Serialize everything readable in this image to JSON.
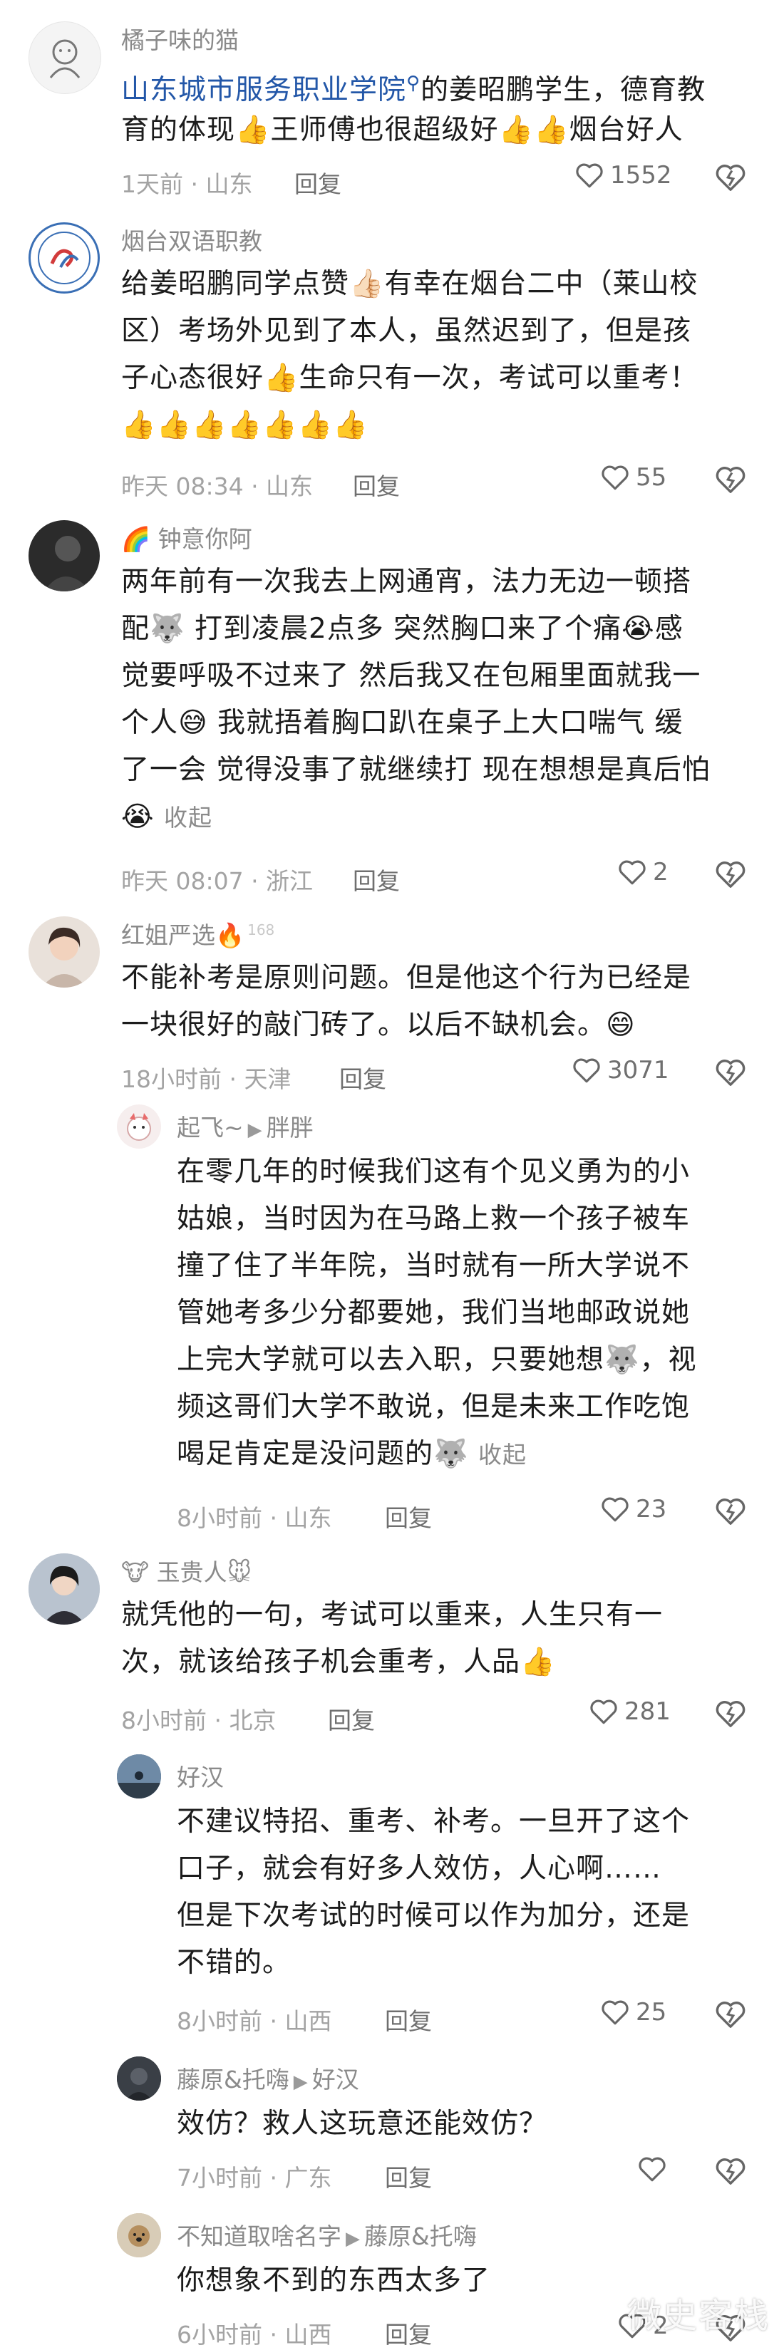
{
  "comments": [
    {
      "name": "橘子味的猫",
      "body_lines": [
        "",
        "育的体现👍王师傅也很超级好👍👍烟台好人"
      ],
      "first_link": "山东城市服务职业学院",
      "first_after": "的姜昭鹏学生，德育教",
      "time": "1天前 · 山东",
      "reply": "回复",
      "likes": "1552"
    },
    {
      "name": "烟台双语职教",
      "body_lines": [
        "给姜昭鹏同学点赞👍🏻有幸在烟台二中（莱山校",
        "区）考场外见到了本人，虽然迟到了，但是孩",
        "子心态很好👍生命只有一次，考试可以重考！",
        "👍👍👍👍👍👍👍"
      ],
      "time": "昨天 08:34 · 山东",
      "reply": "回复",
      "likes": "55"
    },
    {
      "name": "钟意你阿",
      "name_prefix": "🌈",
      "body_lines": [
        "两年前有一次我去上网通宵，法力无边一顿搭",
        "配🐺 打到凌晨2点多 突然胸口来了个痛😭感",
        "觉要呼吸不过来了 然后我又在包厢里面就我一",
        "个人😅 我就捂着胸口趴在桌子上大口喘气 缓",
        "了一会 觉得没事了就继续打 现在想想是真后怕"
      ],
      "last_emoji": "😭",
      "collapse": "收起",
      "time": "昨天 08:07 · 浙江",
      "reply": "回复",
      "likes": "2"
    },
    {
      "name": "红姐严选",
      "name_suffix": "🔥",
      "badge": "168",
      "body_lines": [
        "不能补考是原则问题。但是他这个行为已经是",
        "一块很好的敲门砖了。以后不缺机会。😄"
      ],
      "time": "18小时前 · 天津",
      "reply": "回复",
      "likes": "3071"
    },
    {
      "name": "起飞~",
      "reply_to": "胖胖",
      "body_lines": [
        "在零几年的时候我们这有个见义勇为的小",
        "姑娘，当时因为在马路上救一个孩子被车",
        "撞了住了半年院，当时就有一所大学说不",
        "管她考多少分都要她，我们当地邮政说她",
        "上完大学就可以去入职，只要她想🐺，视",
        "频这哥们大学不敢说，但是未来工作吃饱",
        "喝足肯定是没问题的🐺"
      ],
      "collapse": "收起",
      "time": "8小时前 · 山东",
      "reply": "回复",
      "likes": "23"
    },
    {
      "name": "玉贵人",
      "name_prefix": "🐮",
      "name_suffix": "🐭",
      "body_lines": [
        "就凭他的一句，考试可以重来，人生只有一",
        "次，就该给孩子机会重考，人品👍"
      ],
      "time": "8小时前 · 北京",
      "reply": "回复",
      "likes": "281"
    },
    {
      "name": "好汉",
      "body_lines": [
        "不建议特招、重考、补考。一旦开了这个",
        "口子，就会有好多人效仿，人心啊……",
        "但是下次考试的时候可以作为加分，还是",
        "不错的。"
      ],
      "time": "8小时前 · 山西",
      "reply": "回复",
      "likes": "25"
    },
    {
      "name": "藤原&托嗨",
      "reply_to": "好汉",
      "body_lines": [
        "效仿？救人这玩意还能效仿？"
      ],
      "time": "7小时前 · 广东",
      "reply": "回复",
      "likes": ""
    },
    {
      "name": "不知道取啥名字",
      "reply_to": "藤原&托嗨",
      "body_lines": [
        "你想象不到的东西太多了"
      ],
      "time": "6小时前 · 山西",
      "reply": "回复",
      "likes": "2"
    }
  ],
  "watermark": "微史客栈",
  "icons": [
    "heart-icon",
    "dislike-icon",
    "search-icon",
    "reply-arrow-icon"
  ]
}
